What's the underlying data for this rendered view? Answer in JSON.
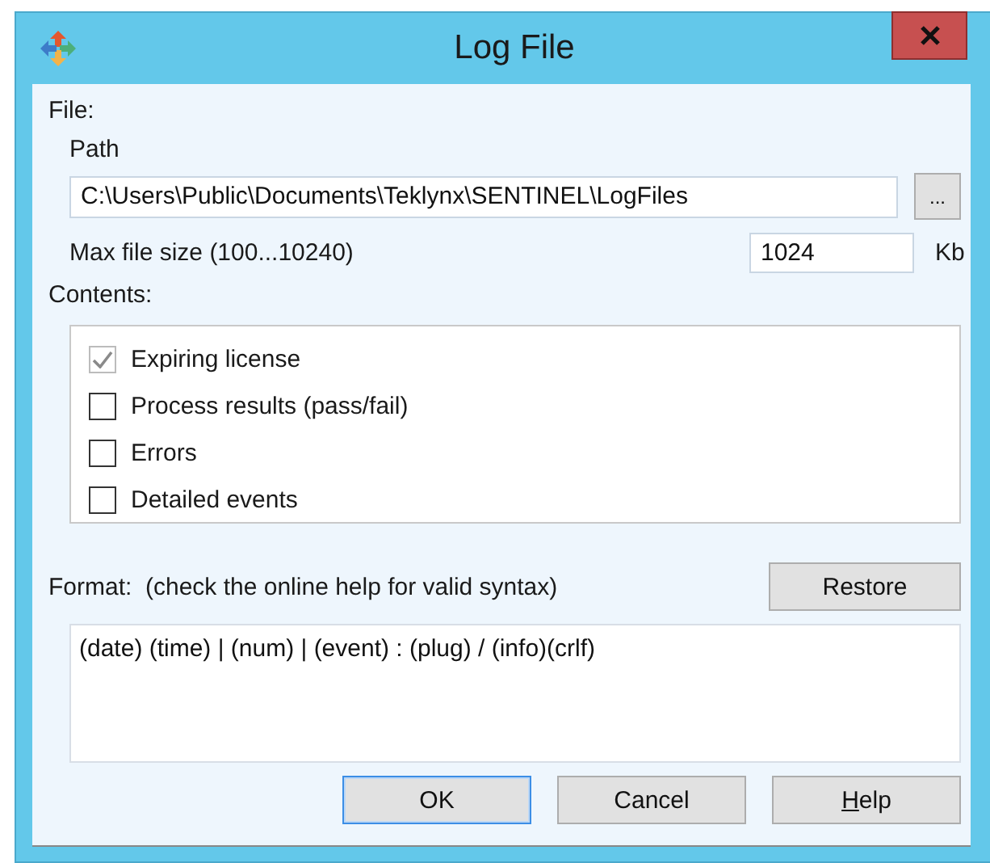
{
  "window": {
    "title": "Log File"
  },
  "file": {
    "label": "File:",
    "path_label": "Path",
    "path": "C:\\Users\\Public\\Documents\\Teklynx\\SENTINEL\\LogFiles",
    "browse_button": "...",
    "size_label": "Max file size (100...10240)",
    "size": "1024",
    "size_unit": "Kb"
  },
  "contents": {
    "label": "Contents:",
    "items": [
      {
        "label": "Expiring license",
        "checked": true,
        "disabled": true
      },
      {
        "label": "Process results (pass/fail)",
        "checked": false,
        "disabled": false
      },
      {
        "label": "Errors",
        "checked": false,
        "disabled": false
      },
      {
        "label": "Detailed events",
        "checked": false,
        "disabled": false
      }
    ]
  },
  "format": {
    "label": "Format:  (check the online help for valid syntax)",
    "restore_button": "Restore",
    "value": "(date) (time) | (num) | (event) : (plug) / (info)(crlf)"
  },
  "buttons": [
    {
      "label": "OK",
      "default": true,
      "mnemonic_underlined": false
    },
    {
      "label": "Cancel",
      "default": false,
      "mnemonic_underlined": false
    },
    {
      "label": "Help",
      "default": false,
      "mnemonic_underlined": true
    }
  ]
}
